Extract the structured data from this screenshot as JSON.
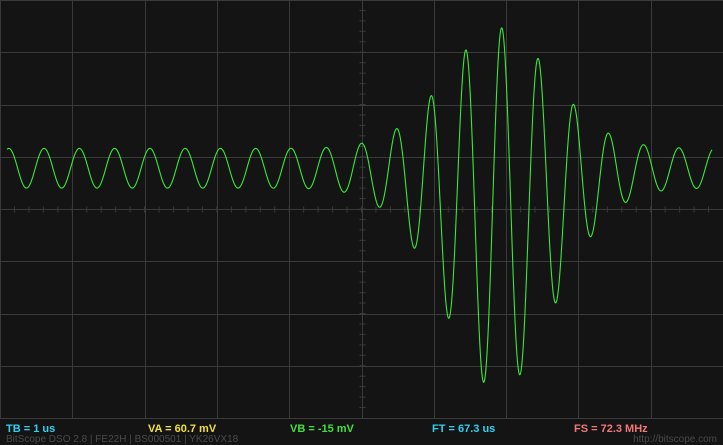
{
  "readouts": {
    "tb": "TB = 1 us",
    "va": "VA = 60.7 mV",
    "vb": "VB = -15 mV",
    "ft": "FT = 67.3 us",
    "fs": "FS = 72.3 MHz"
  },
  "footer": {
    "device": "BitScope DSO 2.8 | FE22H | BS000501 | YK26VX18",
    "site": "http://bitscope.com"
  },
  "colors": {
    "background": "#141414",
    "grid": "#3a3a3a",
    "trace": "#39e83a",
    "tb": "#2fd0f0",
    "va": "#f0e040",
    "vb": "#40e040",
    "ft": "#2fd0f0",
    "fs": "#f07878"
  },
  "chart_data": {
    "type": "line",
    "grid": true,
    "divisions": {
      "x": 10,
      "y": 8
    },
    "ylim": [
      -4,
      4
    ],
    "xlim": [
      0,
      10
    ],
    "series": [
      {
        "color": "#39e83a",
        "cycles_per_division": 2.05,
        "baseline_amplitude_div": 0.38,
        "baseline_offset_div": 0.78,
        "burst_center_div": 6.9,
        "burst_peak_amplitude_div": 3.1,
        "burst_peak_div": 3.55,
        "burst_width_div": 1.1
      }
    ]
  }
}
